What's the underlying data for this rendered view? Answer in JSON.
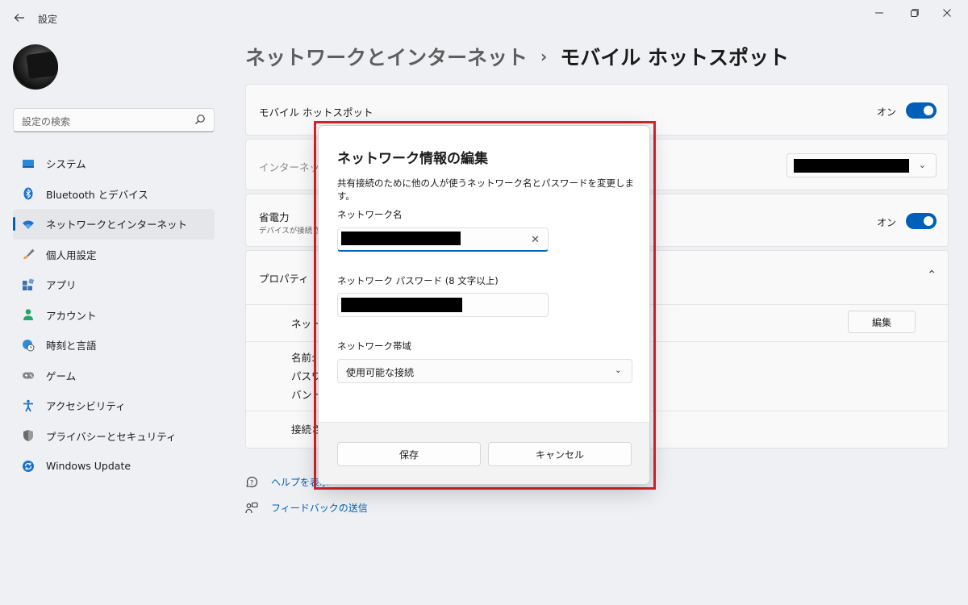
{
  "window": {
    "title": "設定"
  },
  "search": {
    "placeholder": "設定の検索"
  },
  "sidebar": {
    "items": [
      {
        "label": "システム",
        "icon": "system-icon"
      },
      {
        "label": "Bluetooth とデバイス",
        "icon": "bluetooth-icon"
      },
      {
        "label": "ネットワークとインターネット",
        "icon": "wifi-icon",
        "active": true
      },
      {
        "label": "個人用設定",
        "icon": "brush-icon"
      },
      {
        "label": "アプリ",
        "icon": "apps-icon"
      },
      {
        "label": "アカウント",
        "icon": "account-icon"
      },
      {
        "label": "時刻と言語",
        "icon": "globe-clock-icon"
      },
      {
        "label": "ゲーム",
        "icon": "gamepad-icon"
      },
      {
        "label": "アクセシビリティ",
        "icon": "accessibility-icon"
      },
      {
        "label": "プライバシーとセキュリティ",
        "icon": "shield-icon"
      },
      {
        "label": "Windows Update",
        "icon": "update-icon"
      }
    ]
  },
  "breadcrumb": {
    "parent": "ネットワークとインターネット",
    "separator": "›",
    "current": "モバイル ホットスポット"
  },
  "main": {
    "hotspot": {
      "label": "モバイル ホットスポット",
      "state": "オン"
    },
    "share_from": {
      "label": "インターネット接"
    },
    "power_saving": {
      "label": "省電力",
      "sub": "デバイスが接続さ",
      "state": "オン"
    },
    "properties": {
      "label": "プロパティ",
      "network_row": "ネット",
      "edit_label": "編集",
      "name_row": "名前:",
      "password_row": "パスワ",
      "band_row": "バンド",
      "connected_row": "接続さ"
    },
    "links": {
      "help": "ヘルプを表示",
      "feedback": "フィードバックの送信"
    }
  },
  "dialog": {
    "title": "ネットワーク情報の編集",
    "description": "共有接続のために他の人が使うネットワーク名とパスワードを変更します。",
    "network_name_label": "ネットワーク名",
    "password_label": "ネットワーク パスワード (8 文字以上)",
    "band_label": "ネットワーク帯域",
    "band_value": "使用可能な接続",
    "save_label": "保存",
    "cancel_label": "キャンセル"
  },
  "colors": {
    "accent": "#005fb8",
    "highlight": "#d9232a"
  }
}
